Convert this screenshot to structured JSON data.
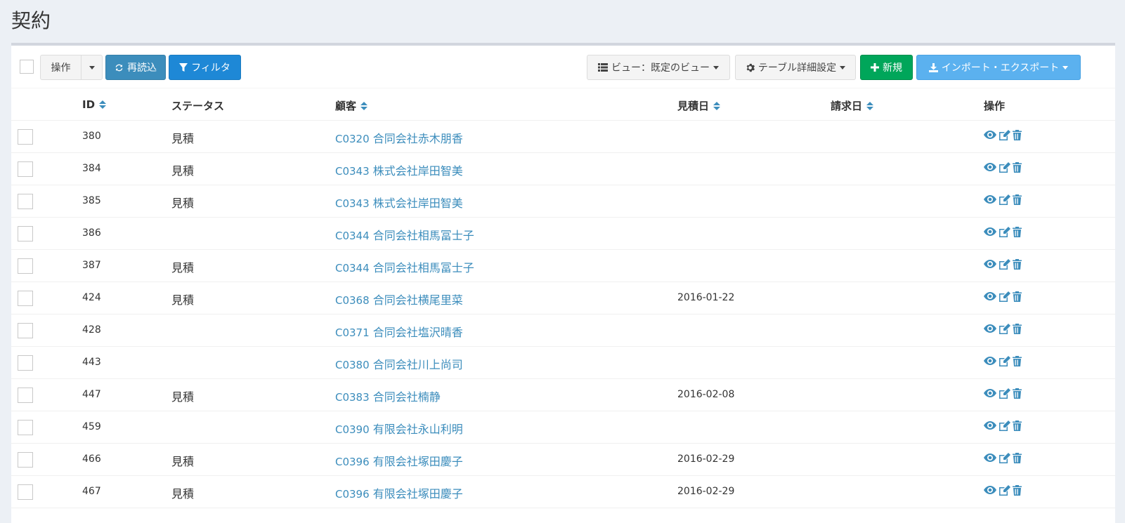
{
  "page": {
    "title": "契約"
  },
  "toolbar": {
    "action_label": "操作",
    "reload_label": "再読込",
    "filter_label": "フィルタ",
    "view_label": "ビュー：既定のビュー",
    "table_settings_label": "テーブル詳細設定",
    "new_label": "新規",
    "import_export_label": "インポート・エクスポート"
  },
  "table": {
    "columns": {
      "id": "ID",
      "status": "ステータス",
      "customer": "顧客",
      "quote_date": "見積日",
      "bill_date": "請求日",
      "actions": "操作"
    },
    "rows": [
      {
        "id": "380",
        "status": "見積",
        "code": "C0320",
        "customer": "合同会社赤木朋香",
        "quote_date": "",
        "bill_date": ""
      },
      {
        "id": "384",
        "status": "見積",
        "code": "C0343",
        "customer": "株式会社岸田智美",
        "quote_date": "",
        "bill_date": ""
      },
      {
        "id": "385",
        "status": "見積",
        "code": "C0343",
        "customer": "株式会社岸田智美",
        "quote_date": "",
        "bill_date": ""
      },
      {
        "id": "386",
        "status": "",
        "code": "C0344",
        "customer": "合同会社相馬冨士子",
        "quote_date": "",
        "bill_date": ""
      },
      {
        "id": "387",
        "status": "見積",
        "code": "C0344",
        "customer": "合同会社相馬冨士子",
        "quote_date": "",
        "bill_date": ""
      },
      {
        "id": "424",
        "status": "見積",
        "code": "C0368",
        "customer": "合同会社横尾里菜",
        "quote_date": "2016-01-22",
        "bill_date": ""
      },
      {
        "id": "428",
        "status": "",
        "code": "C0371",
        "customer": "合同会社塩沢晴香",
        "quote_date": "",
        "bill_date": ""
      },
      {
        "id": "443",
        "status": "",
        "code": "C0380",
        "customer": "合同会社川上尚司",
        "quote_date": "",
        "bill_date": ""
      },
      {
        "id": "447",
        "status": "見積",
        "code": "C0383",
        "customer": "合同会社楠静",
        "quote_date": "2016-02-08",
        "bill_date": ""
      },
      {
        "id": "459",
        "status": "",
        "code": "C0390",
        "customer": "有限会社永山利明",
        "quote_date": "",
        "bill_date": ""
      },
      {
        "id": "466",
        "status": "見積",
        "code": "C0396",
        "customer": "有限会社塚田慶子",
        "quote_date": "2016-02-29",
        "bill_date": ""
      },
      {
        "id": "467",
        "status": "見積",
        "code": "C0396",
        "customer": "有限会社塚田慶子",
        "quote_date": "2016-02-29",
        "bill_date": ""
      }
    ]
  },
  "colors": {
    "link": "#3c8dbc",
    "success": "#00a65a",
    "primary": "#3c8dbc"
  },
  "icons": [
    "refresh-icon",
    "filter-icon",
    "list-icon",
    "gear-icon",
    "plus-icon",
    "download-icon",
    "eye-icon",
    "edit-icon",
    "trash-icon",
    "sort-icon"
  ]
}
